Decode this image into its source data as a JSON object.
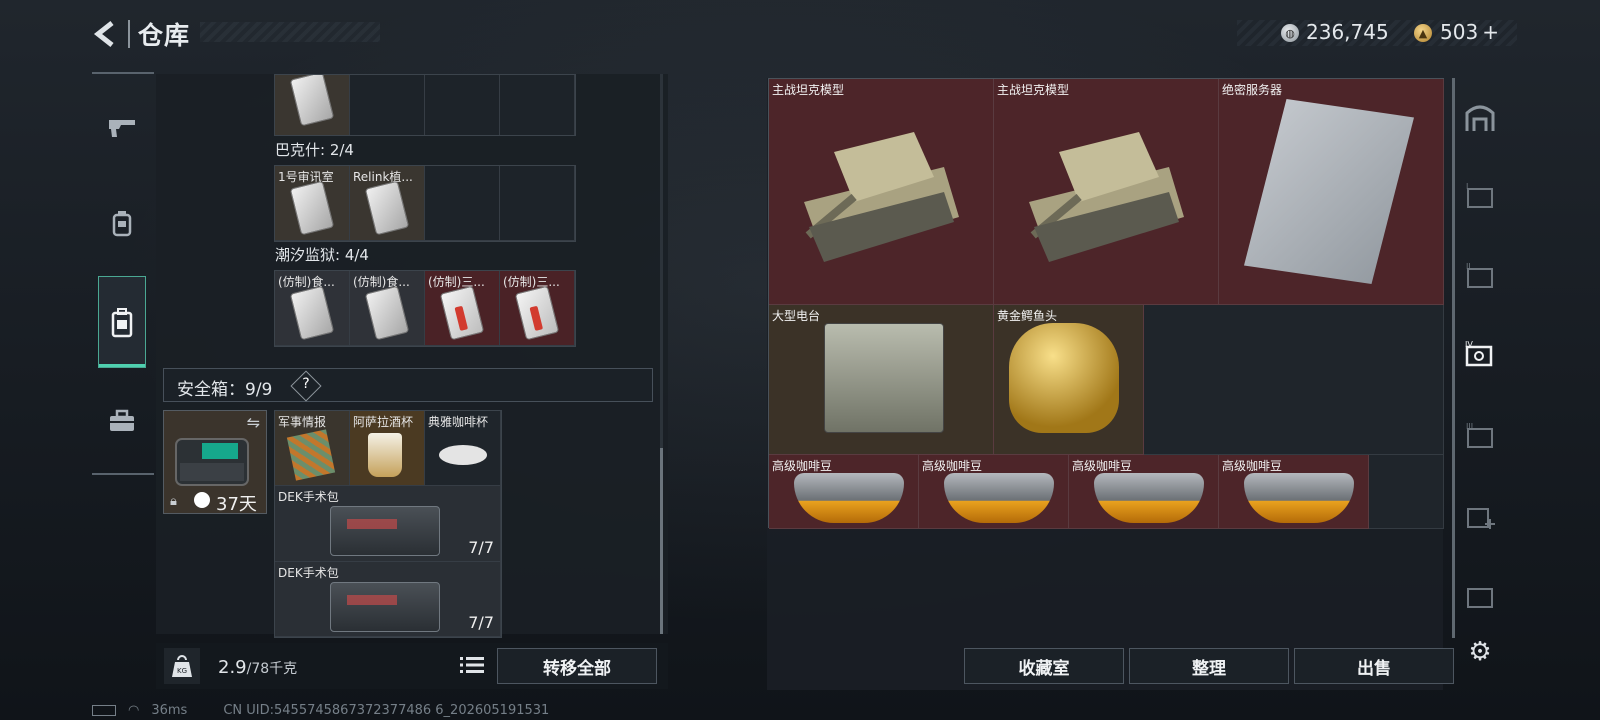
{
  "header": {
    "title": "仓库",
    "money": "236,745",
    "gold": "503",
    "gold_plus": "+"
  },
  "left": {
    "sections": [
      {
        "label": "巴克什: 2/4",
        "items": [
          {
            "name": "1号审讯室"
          },
          {
            "name": "Relink植..."
          }
        ]
      },
      {
        "label": "潮汐监狱: 4/4",
        "items": [
          {
            "name": "(仿制)食..."
          },
          {
            "name": "(仿制)食..."
          },
          {
            "name": "(仿制)三..."
          },
          {
            "name": "(仿制)三..."
          }
        ]
      }
    ],
    "safe": {
      "title": "安全箱：9/9",
      "help": "?",
      "days": "37天",
      "items": [
        {
          "name": "军事情报"
        },
        {
          "name": "阿萨拉酒杯"
        },
        {
          "name": "典雅咖啡杯"
        }
      ],
      "kits": [
        {
          "name": "DEK手术包",
          "count": "7/7"
        },
        {
          "name": "DEK手术包",
          "count": "7/7"
        }
      ]
    },
    "weight": {
      "current": "2.9",
      "max": "/78千克"
    },
    "transfer": "转移全部"
  },
  "right": {
    "items": [
      {
        "name": "主战坦克模型"
      },
      {
        "name": "主战坦克模型"
      },
      {
        "name": "绝密服务器"
      },
      {
        "name": "大型电台"
      },
      {
        "name": "黄金鳄鱼头"
      },
      {
        "name": "高级咖啡豆"
      },
      {
        "name": "高级咖啡豆"
      },
      {
        "name": "高级咖啡豆"
      },
      {
        "name": "高级咖啡豆"
      }
    ],
    "buttons": {
      "collection": "收藏室",
      "sort": "整理",
      "sell": "出售"
    }
  },
  "status": {
    "ping": "36ms",
    "uid": "CN UID:5455745867372377486 6_202605191531"
  }
}
